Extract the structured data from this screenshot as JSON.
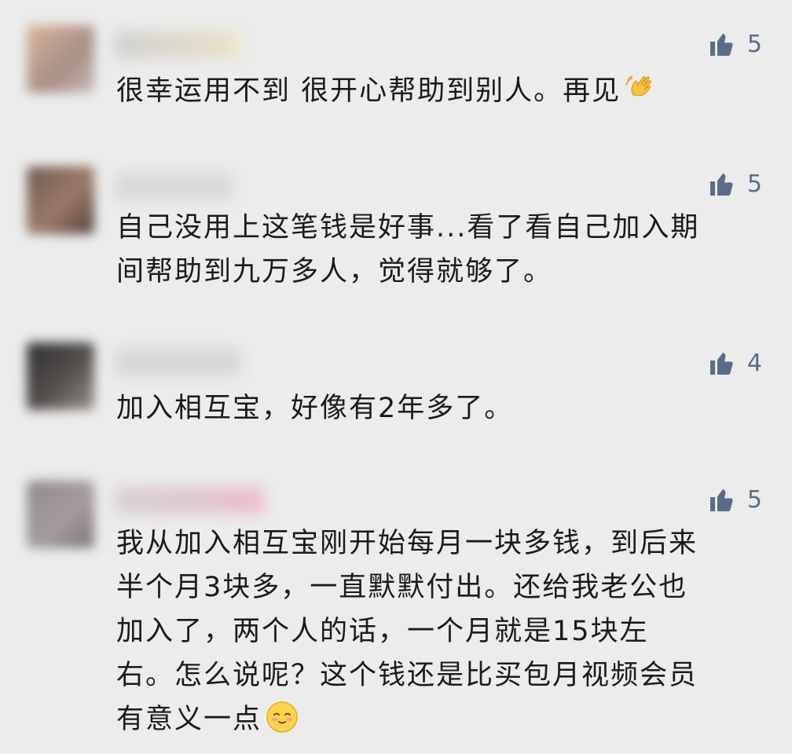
{
  "comments": [
    {
      "likes": "5",
      "text": "很幸运用不到 很开心帮助到别人。再见",
      "emoji": "waving-hand-icon"
    },
    {
      "likes": "5",
      "text": "自己没用上这笔钱是好事...看了看自己加入期\n间帮助到九万多人，觉得就够了。"
    },
    {
      "likes": "4",
      "text": "加入相互宝，好像有2年多了。"
    },
    {
      "likes": "5",
      "text": "我从加入相互宝刚开始每月一块多钱，到后来\n半个月3块多，一直默默付出。还给我老公也\n加入了，两个人的话，一个月就是15块左\n右。怎么说呢？这个钱还是比买包月视频会员\n有意义一点",
      "emoji": "smiling-face-icon"
    }
  ],
  "colors": {
    "background": "#ececec",
    "like": "#5b6b8a",
    "text": "#1a1a1a"
  }
}
